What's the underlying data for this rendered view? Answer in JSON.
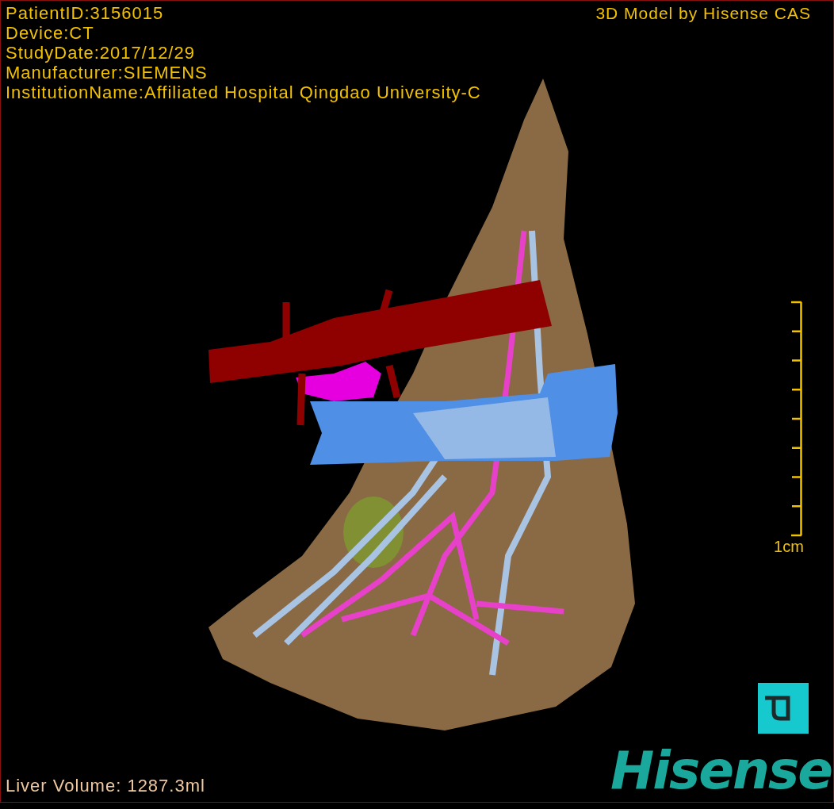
{
  "info_lines": [
    "PatientID:3156015",
    "Device:CT",
    "StudyDate:2017/12/29",
    "Manufacturer:SIEMENS",
    "InstitutionName:Affiliated Hospital Qingdao University-C"
  ],
  "credit": "3D Model by Hisense CAS",
  "scale_bar": {
    "label": "1cm"
  },
  "volume": "Liver Volume: 1287.3ml",
  "logo": "Hisense"
}
